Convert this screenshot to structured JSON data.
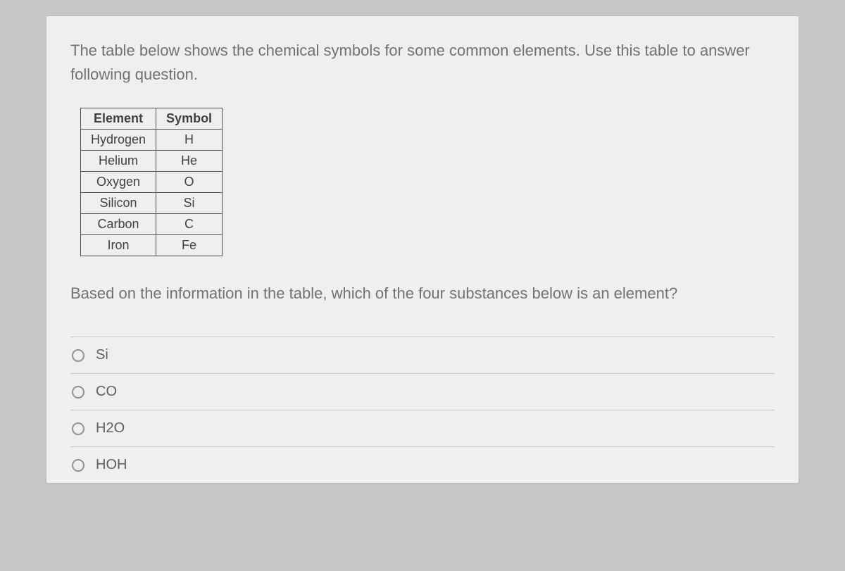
{
  "intro": "The table below shows the chemical symbols for some common elements. Use this table to answer following question.",
  "table": {
    "headers": {
      "element": "Element",
      "symbol": "Symbol"
    },
    "rows": [
      {
        "element": "Hydrogen",
        "symbol": "H"
      },
      {
        "element": "Helium",
        "symbol": "He"
      },
      {
        "element": "Oxygen",
        "symbol": "O"
      },
      {
        "element": "Silicon",
        "symbol": "Si"
      },
      {
        "element": "Carbon",
        "symbol": "C"
      },
      {
        "element": "Iron",
        "symbol": "Fe"
      }
    ]
  },
  "prompt": "Based on the information in the table, which of the four substances below is an element?",
  "options": [
    {
      "label": "Si"
    },
    {
      "label": "CO"
    },
    {
      "label": "H2O"
    },
    {
      "label": "HOH"
    }
  ]
}
